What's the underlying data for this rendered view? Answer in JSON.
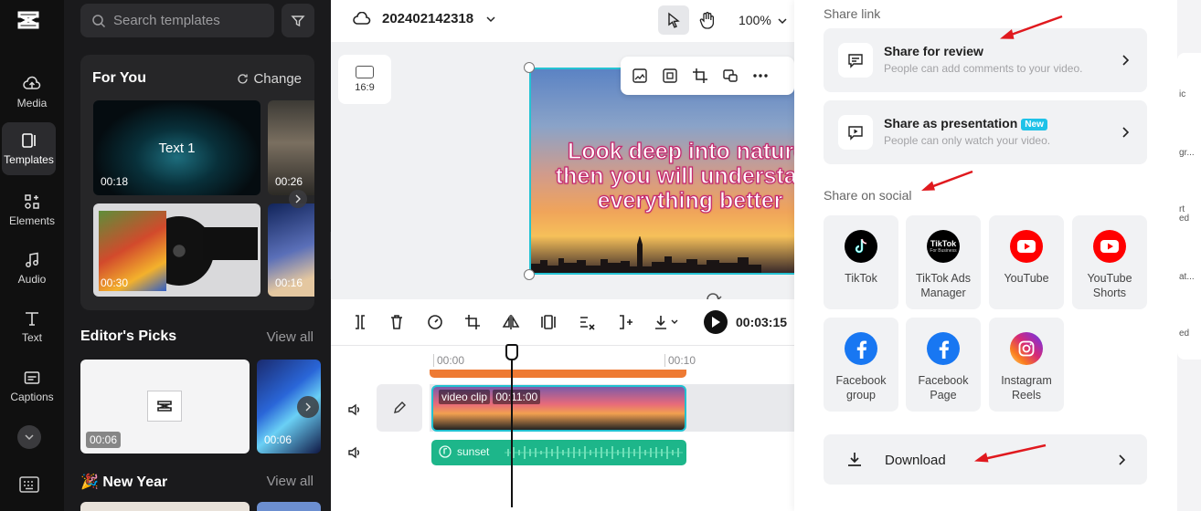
{
  "nav": {
    "items": [
      {
        "label": "Media",
        "icon": "cloud-upload-icon"
      },
      {
        "label": "Templates",
        "icon": "templates-icon"
      },
      {
        "label": "Elements",
        "icon": "elements-icon"
      },
      {
        "label": "Audio",
        "icon": "music-note-icon"
      },
      {
        "label": "Text",
        "icon": "text-icon"
      },
      {
        "label": "Captions",
        "icon": "captions-icon"
      }
    ]
  },
  "panel": {
    "search_placeholder": "Search templates",
    "for_you": {
      "title": "For You",
      "change_label": "Change",
      "templates": [
        {
          "label": "Text 1",
          "duration": "00:18"
        },
        {
          "duration": "00:26"
        },
        {
          "duration": "00:30"
        },
        {
          "duration": "00:16"
        }
      ]
    },
    "editors_picks": {
      "title": "Editor's Picks",
      "view_all": "View all",
      "items": [
        {
          "duration": "00:06"
        },
        {
          "duration": "00:06"
        }
      ]
    },
    "new_year": {
      "title": "🎉 New Year",
      "view_all": "View all"
    }
  },
  "editor": {
    "project_name": "202402142318",
    "zoom": "100%",
    "aspect_ratio": "16:9",
    "canvas_text": "Look deep into nature, then you will understand everything better",
    "time": "00:03:15",
    "timeline": {
      "ruler": [
        "00:00",
        "00:10"
      ],
      "video_clip_label": "video clip",
      "video_clip_duration": "00:11:00",
      "audio_clip_label": "sunset"
    }
  },
  "share": {
    "share_link_label": "Share link",
    "review": {
      "title": "Share for review",
      "desc": "People can add comments to your video."
    },
    "presentation": {
      "title": "Share as presentation",
      "badge": "New",
      "desc": "People can only watch your video."
    },
    "social_label": "Share on social",
    "social": [
      {
        "name": "TikTok",
        "icon": "tiktok-icon",
        "color": "#000000"
      },
      {
        "name": "TikTok Ads Manager",
        "icon": "tiktok-ads-icon",
        "color": "#000000"
      },
      {
        "name": "YouTube",
        "icon": "youtube-icon",
        "color": "#ff0000"
      },
      {
        "name": "YouTube Shorts",
        "icon": "youtube-shorts-icon",
        "color": "#ff0000"
      },
      {
        "name": "Facebook group",
        "icon": "facebook-icon",
        "color": "#1877f2"
      },
      {
        "name": "Facebook Page",
        "icon": "facebook-icon",
        "color": "#1877f2"
      },
      {
        "name": "Instagram Reels",
        "icon": "instagram-icon",
        "color": "#e1306c"
      }
    ],
    "tiktok_ads_logo_text": "TikTok",
    "tiktok_ads_logo_sub": "For Business",
    "download_label": "Download"
  },
  "right_panel": {
    "fragments": [
      "ic",
      "gr...",
      "rt",
      "ed",
      "at...",
      "ed"
    ]
  },
  "colors": {
    "accent_cyan": "#22c1d1",
    "audio_green": "#1db68a",
    "annotation_red": "#e0191e"
  }
}
